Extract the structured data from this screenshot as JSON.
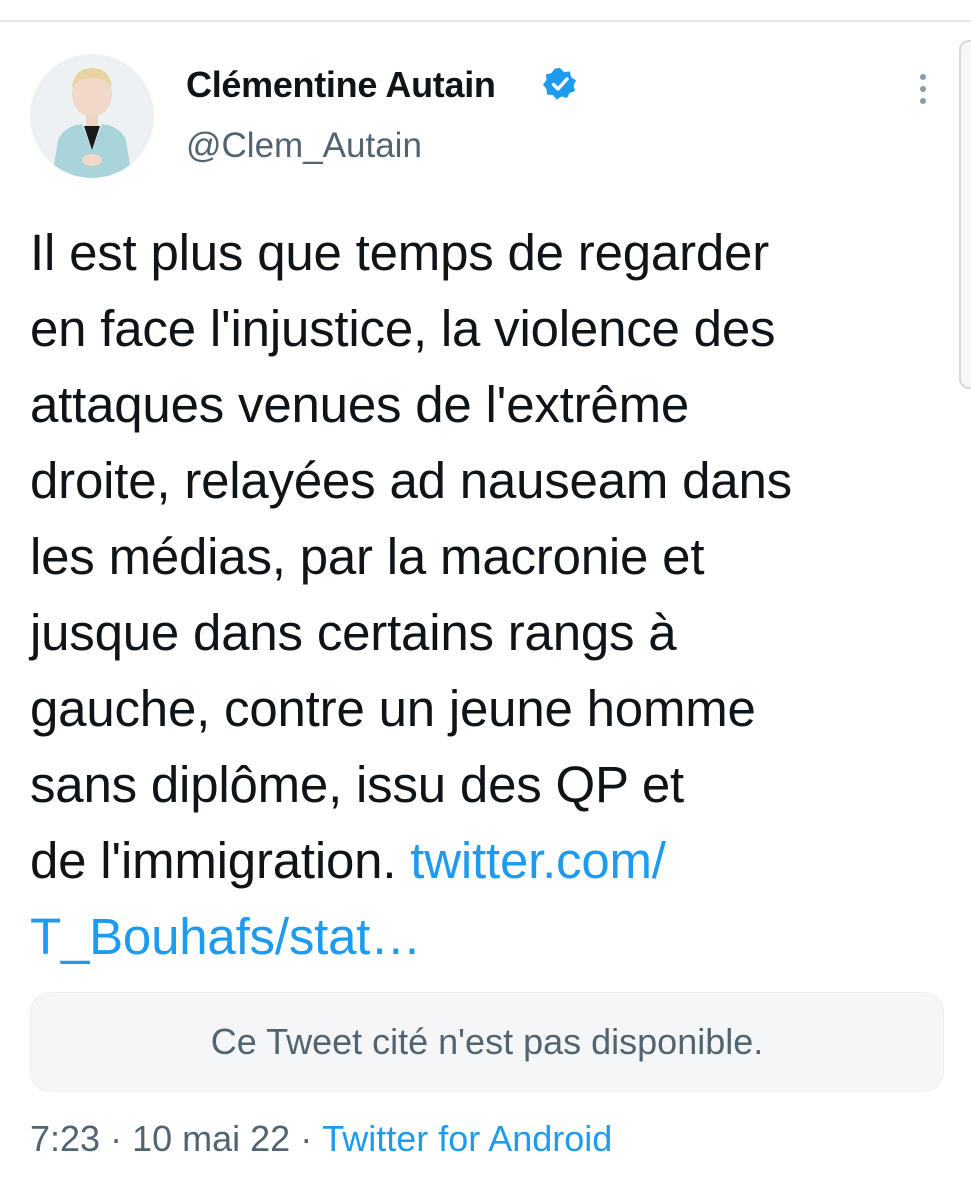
{
  "tweet": {
    "author": {
      "display_name": "Clémentine Autain",
      "handle": "@Clem_Autain",
      "avatar_icon": "profile-photo",
      "verified_icon": "verified-badge-icon"
    },
    "text_lines": [
      "Il est plus que temps de regarder",
      "en face l'injustice, la violence des",
      "attaques venues de l'extrême",
      "droite, relayées ad nauseam dans",
      "les médias, par la macronie et",
      "jusque dans certains rangs à",
      "gauche, contre un jeune homme",
      "sans diplôme, issu des QP et"
    ],
    "last_line_text": "de l'immigration. ",
    "link_part1": "twitter.com/",
    "link_part2": "T_Bouhafs/stat…",
    "quoted_tweet_notice": "Ce Tweet cité n'est pas disponible.",
    "time": "7:23",
    "separator": "·",
    "date": "10 mai 22",
    "source": "Twitter for Android",
    "more_icon": "more-vertical-icon"
  },
  "colors": {
    "link": "#1d9bf0",
    "secondary_text": "#536471",
    "quote_background": "#f4f6f8",
    "verified": "#1d9bf0"
  }
}
